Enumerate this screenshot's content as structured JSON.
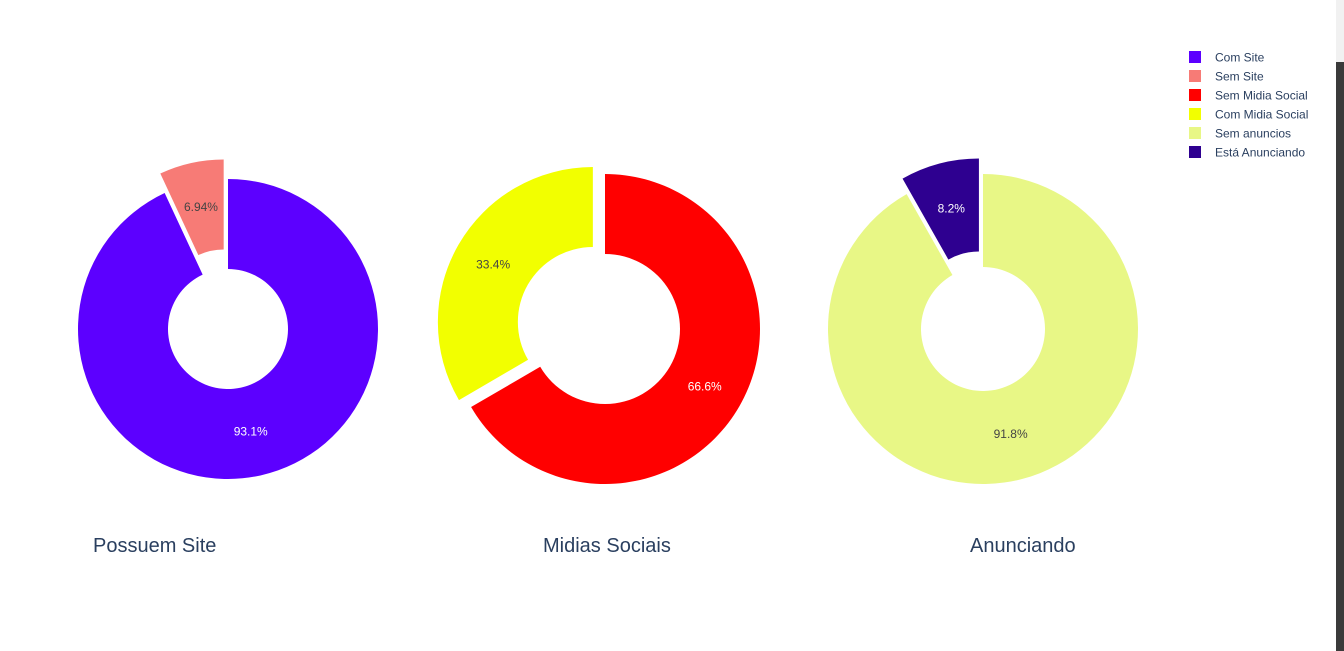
{
  "chart_data": [
    {
      "type": "pie",
      "hole": true,
      "title": "Possuem Site",
      "slices": [
        {
          "label": "Com Site",
          "value": 93.06,
          "text": "93.1%",
          "color": "#5c00ff",
          "text_color": "#ffffff",
          "pulled": false
        },
        {
          "label": "Sem Site",
          "value": 6.94,
          "text": "6.94%",
          "color": "#f77b76",
          "text_color": "#444444",
          "pulled": true
        }
      ]
    },
    {
      "type": "pie",
      "hole": true,
      "title": "Midias Sociais",
      "slices": [
        {
          "label": "Sem Midia Social",
          "value": 66.6,
          "text": "66.6%",
          "color": "#ff0000",
          "text_color": "#ffffff",
          "pulled": false
        },
        {
          "label": "Com Midia Social",
          "value": 33.4,
          "text": "33.4%",
          "color": "#f2ff00",
          "text_color": "#444444",
          "pulled": true
        }
      ]
    },
    {
      "type": "pie",
      "hole": true,
      "title": "Anunciando",
      "slices": [
        {
          "label": "Sem anuncios",
          "value": 91.8,
          "text": "91.8%",
          "color": "#e8f786",
          "text_color": "#444444",
          "pulled": false
        },
        {
          "label": "Está Anunciando",
          "value": 8.2,
          "text": "8.2%",
          "color": "#2e0090",
          "text_color": "#ffffff",
          "pulled": true
        }
      ]
    }
  ],
  "legend": {
    "placement": "top-right",
    "items": [
      {
        "label": "Com Site",
        "color": "#5c00ff"
      },
      {
        "label": "Sem Site",
        "color": "#f77b76"
      },
      {
        "label": "Sem Midia Social",
        "color": "#ff0000"
      },
      {
        "label": "Com Midia Social",
        "color": "#f2ff00"
      },
      {
        "label": "Sem anuncios",
        "color": "#e8f786"
      },
      {
        "label": "Está Anunciando",
        "color": "#2e0090"
      }
    ]
  }
}
